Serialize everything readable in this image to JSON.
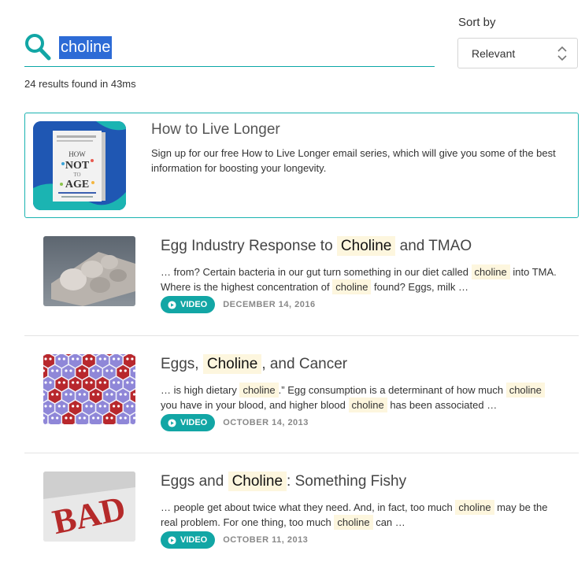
{
  "search": {
    "query": "choline"
  },
  "sort": {
    "label": "Sort by",
    "value": "Relevant"
  },
  "results_summary": "24 results found in 43ms",
  "promo": {
    "title": "How to Live Longer",
    "description": "Sign up for our free How to Live Longer email series, which will give you some of the best information for boosting your longevity.",
    "cover_text": [
      "HOW",
      "NOT",
      "TO",
      "AGE"
    ]
  },
  "results": [
    {
      "title_pre": "Egg Industry Response to ",
      "title_hl": "Choline",
      "title_post": " and TMAO",
      "snip": [
        "… from? Certain bacteria in our gut turn something in our diet called ",
        "choline",
        " into TMA. Where is the highest concentration of ",
        "choline",
        " found? Eggs, milk …"
      ],
      "badge": "VIDEO",
      "date": "DECEMBER 14, 2016"
    },
    {
      "title_pre": "Eggs, ",
      "title_hl": "Choline",
      "title_post": ", and Cancer",
      "snip": [
        "… is high dietary ",
        "choline",
        ".” Egg consumption is a determinant of how much ",
        "choline",
        " you have in your blood, and higher blood ",
        "choline",
        " has been associated …"
      ],
      "badge": "VIDEO",
      "date": "OCTOBER 14, 2013"
    },
    {
      "title_pre": "Eggs and ",
      "title_hl": "Choline",
      "title_post": ": Something Fishy",
      "snip": [
        "… people get about twice what they need. And, in fact, too much ",
        "choline",
        " may be the real problem. For one thing, too much ",
        "choline",
        " can …"
      ],
      "badge": "VIDEO",
      "date": "OCTOBER 11, 2013",
      "thumb_text": "BAD"
    }
  ],
  "colors": {
    "accent": "#12a6a5",
    "highlight": "#fdf6de",
    "selection": "#2d6bd6"
  }
}
